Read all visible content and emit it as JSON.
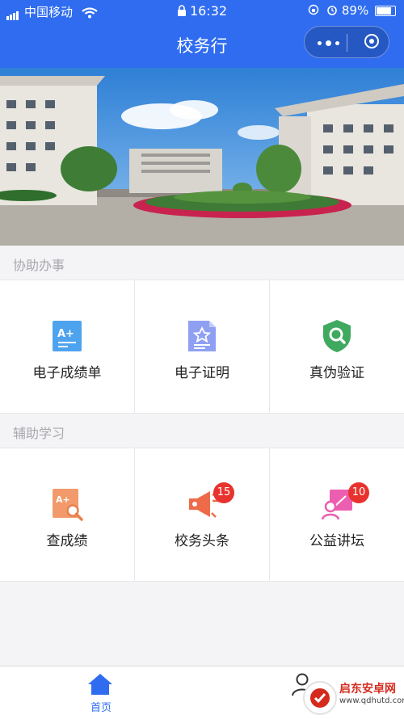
{
  "status_bar": {
    "carrier": "中国移动",
    "time": "16:32",
    "battery": "89%",
    "battery_level": 0.89
  },
  "nav": {
    "title": "校务行"
  },
  "sections": [
    {
      "label": "协助办事",
      "items": [
        {
          "label": "电子成绩单",
          "icon": "transcript-icon"
        },
        {
          "label": "电子证明",
          "icon": "certificate-icon"
        },
        {
          "label": "真伪验证",
          "icon": "verify-shield-icon"
        }
      ]
    },
    {
      "label": "辅助学习",
      "items": [
        {
          "label": "查成绩",
          "icon": "grade-search-icon"
        },
        {
          "label": "校务头条",
          "icon": "megaphone-icon",
          "badge": "15"
        },
        {
          "label": "公益讲坛",
          "icon": "lecture-icon",
          "badge": "10"
        }
      ]
    }
  ],
  "tabbar": {
    "tabs": [
      {
        "label": "首页",
        "icon": "home-icon",
        "active": true
      },
      {
        "label": "",
        "icon": "user-icon"
      }
    ]
  },
  "watermark": {
    "text": "启东安卓网",
    "url": "www.qdhutd.com"
  },
  "colors": {
    "primary": "#2f6cf0",
    "badge": "#e8322e"
  }
}
